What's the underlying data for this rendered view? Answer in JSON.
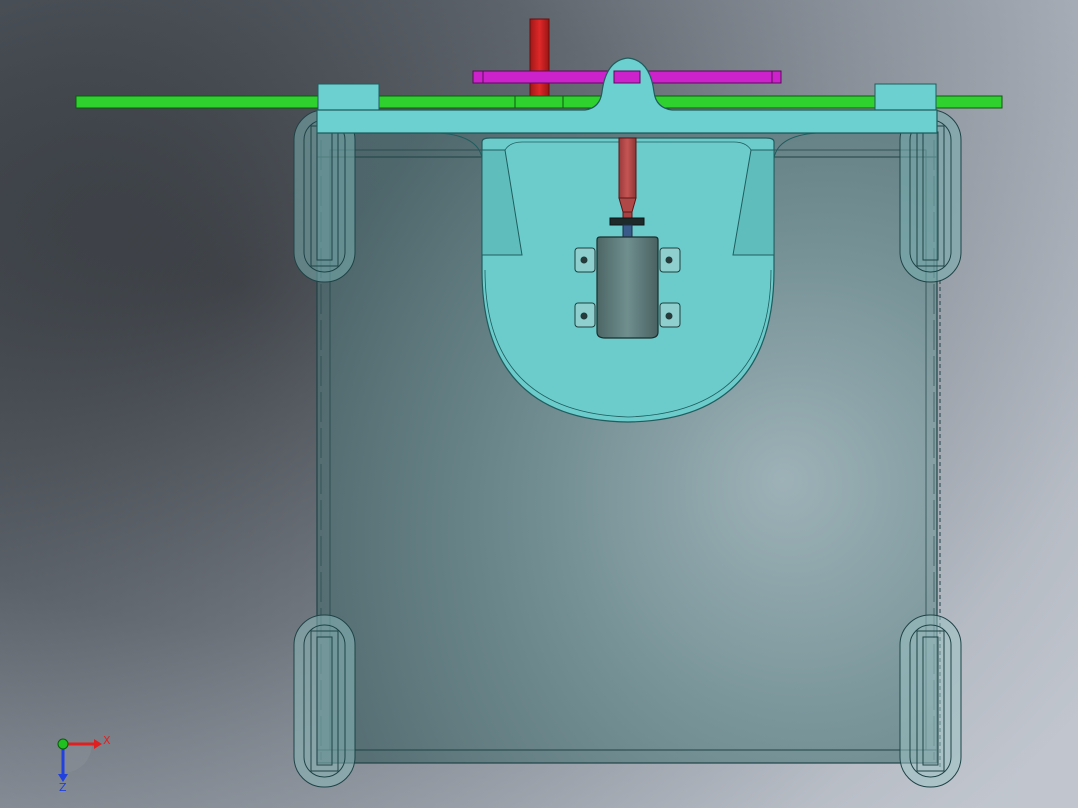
{
  "viewport": {
    "background_dark": "#26292d",
    "background_mid": "#5a6068",
    "background_light": "#b6bcc6"
  },
  "colors": {
    "body_fill": "#5f8f93",
    "body_stroke": "#1e4346",
    "bracket_fill": "#6cd0d0",
    "bracket_stroke": "#1f5d5e",
    "green_rail": "#2fd12f",
    "magenta_bar": "#cc22cc",
    "red_shaft": "#cc2020",
    "motor_fill": "#5e7c7c",
    "mount_fill": "#8fd0cf"
  },
  "triad": {
    "x_label": "X",
    "z_label": "Z",
    "x_color": "#e02020",
    "y_color": "#20c020",
    "z_color": "#2040e0"
  }
}
